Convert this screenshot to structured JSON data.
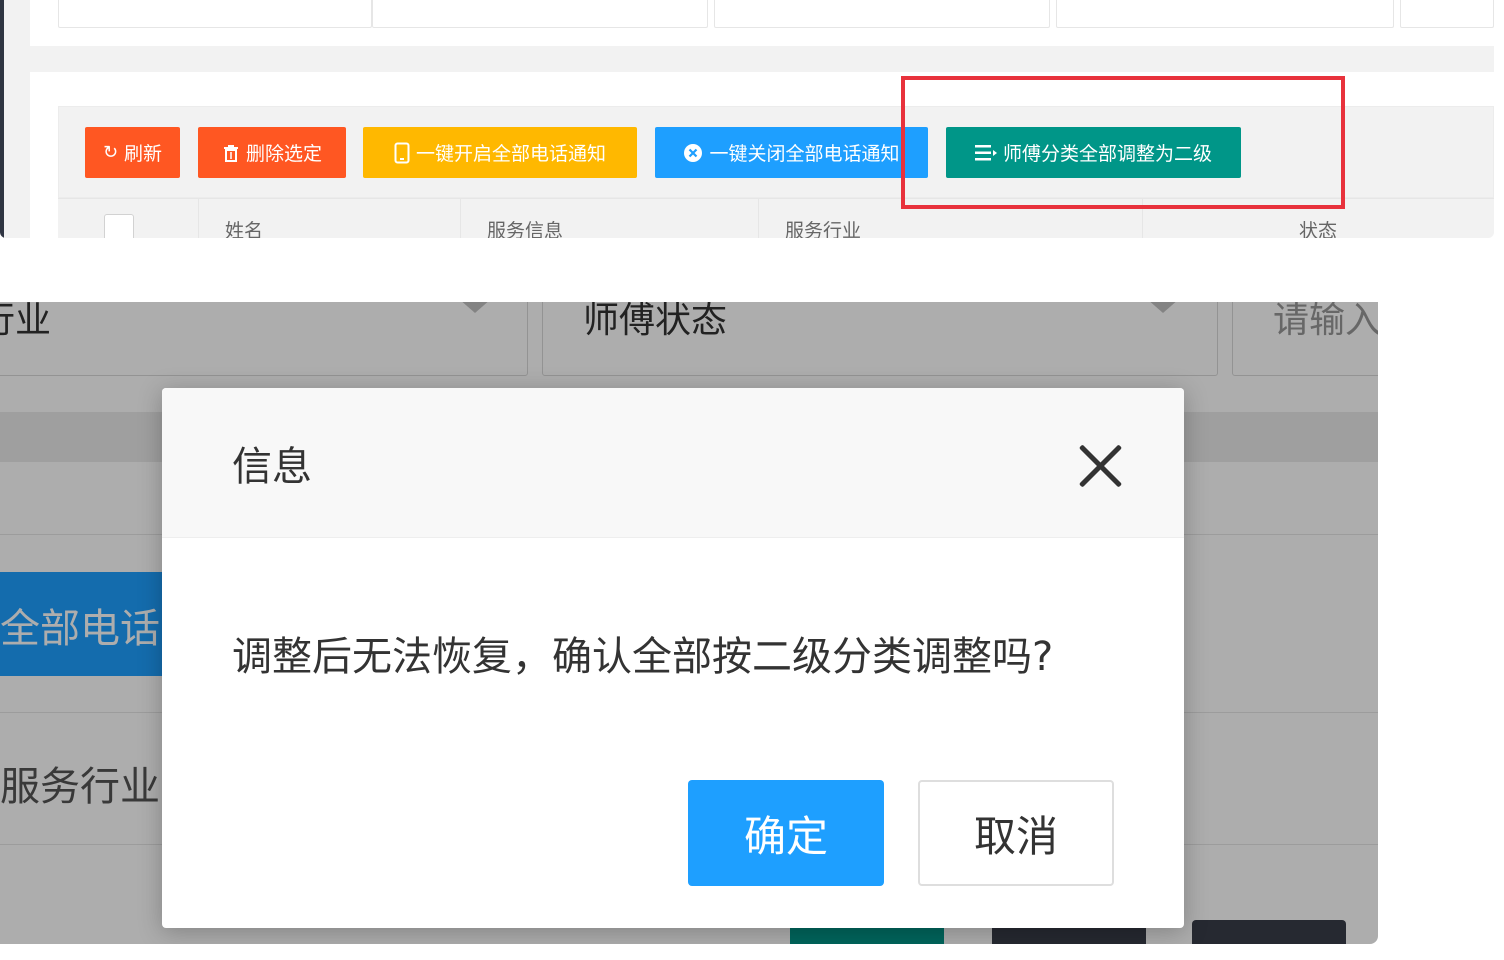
{
  "top": {
    "toolbar": {
      "refresh": {
        "label": "刷新",
        "icon": "refresh-icon"
      },
      "delete_selected": {
        "label": "删除选定",
        "icon": "trash-icon"
      },
      "enable_all_phone": {
        "label": "一键开启全部电话通知",
        "icon": "phone-icon"
      },
      "disable_all_phone": {
        "label": "一键关闭全部电话通知",
        "icon": "close-circle-icon"
      },
      "adjust_all_level2": {
        "label": "师傅分类全部调整为二级",
        "icon": "list-icon"
      }
    },
    "table_headers": [
      "姓名",
      "服务信息",
      "服务行业",
      "状态"
    ],
    "highlight_color": "#e8323c"
  },
  "bottom": {
    "filters": {
      "industry_partial": "行业",
      "worker_status": "师傅状态",
      "input_partial": "请输入"
    },
    "bg_button_partial": "全部电话",
    "bg_label_partial": "服务行业",
    "dialog": {
      "title": "信息",
      "message": "调整后无法恢复，确认全部按二级分类调整吗?",
      "ok_label": "确定",
      "cancel_label": "取消"
    }
  },
  "colors": {
    "orange": "#ff5722",
    "yellow": "#ffb800",
    "blue": "#1e9fff",
    "teal": "#009688"
  }
}
